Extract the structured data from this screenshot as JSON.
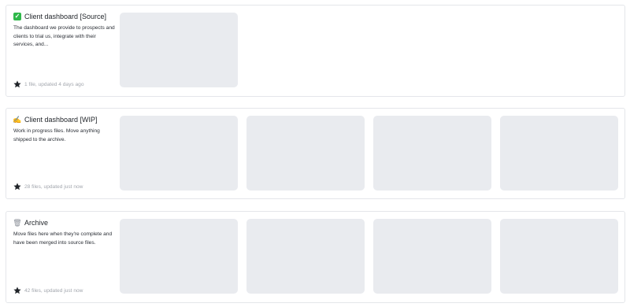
{
  "projects": [
    {
      "icon": "check-icon",
      "icon_glyph": "✓",
      "title": "Client dashboard [Source]",
      "description": "The dashboard we provide to prospects and clients to trial us, integrate with their services, and...",
      "meta": "1 file, updated 4 days ago",
      "thumbnail_count": 1
    },
    {
      "icon": "writing-hand-icon",
      "icon_glyph": "✍",
      "title": "Client dashboard [WIP]",
      "description": "Work in progress files. Move anything shipped to the archive.",
      "meta": "28 files, updated just now",
      "thumbnail_count": 4
    },
    {
      "icon": "trash-icon",
      "icon_glyph": "🗑",
      "title": "Archive",
      "description": "Move files here when they're complete and have been merged into source files.",
      "meta": "42 files, updated just now",
      "thumbnail_count": 4
    }
  ],
  "colors": {
    "thumbnail_bg": "#e9ebef",
    "card_border": "#e4e6ea",
    "meta_text": "#a3a7ae",
    "check_green": "#2fb84a"
  }
}
